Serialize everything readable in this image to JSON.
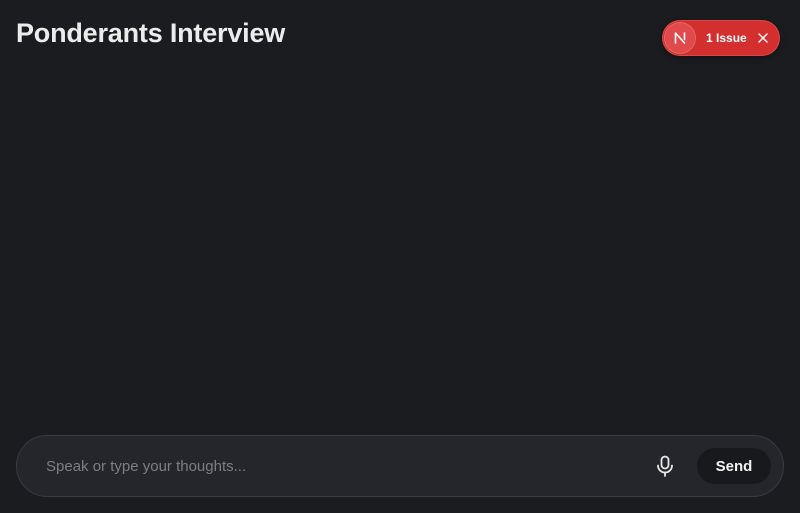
{
  "header": {
    "title": "Ponderants Interview"
  },
  "dev_overlay": {
    "logo_letter": "N",
    "issues_label": "1 Issue",
    "logo_icon": "nextjs-logo-icon",
    "close_icon": "close-icon",
    "accent_color": "#d42f2f"
  },
  "composer": {
    "placeholder": "Speak or type your thoughts...",
    "value": "",
    "mic_icon": "microphone-icon",
    "send_label": "Send"
  },
  "colors": {
    "background": "#1b1c20",
    "composer_background": "#25262b",
    "send_button_background": "#18191c"
  }
}
